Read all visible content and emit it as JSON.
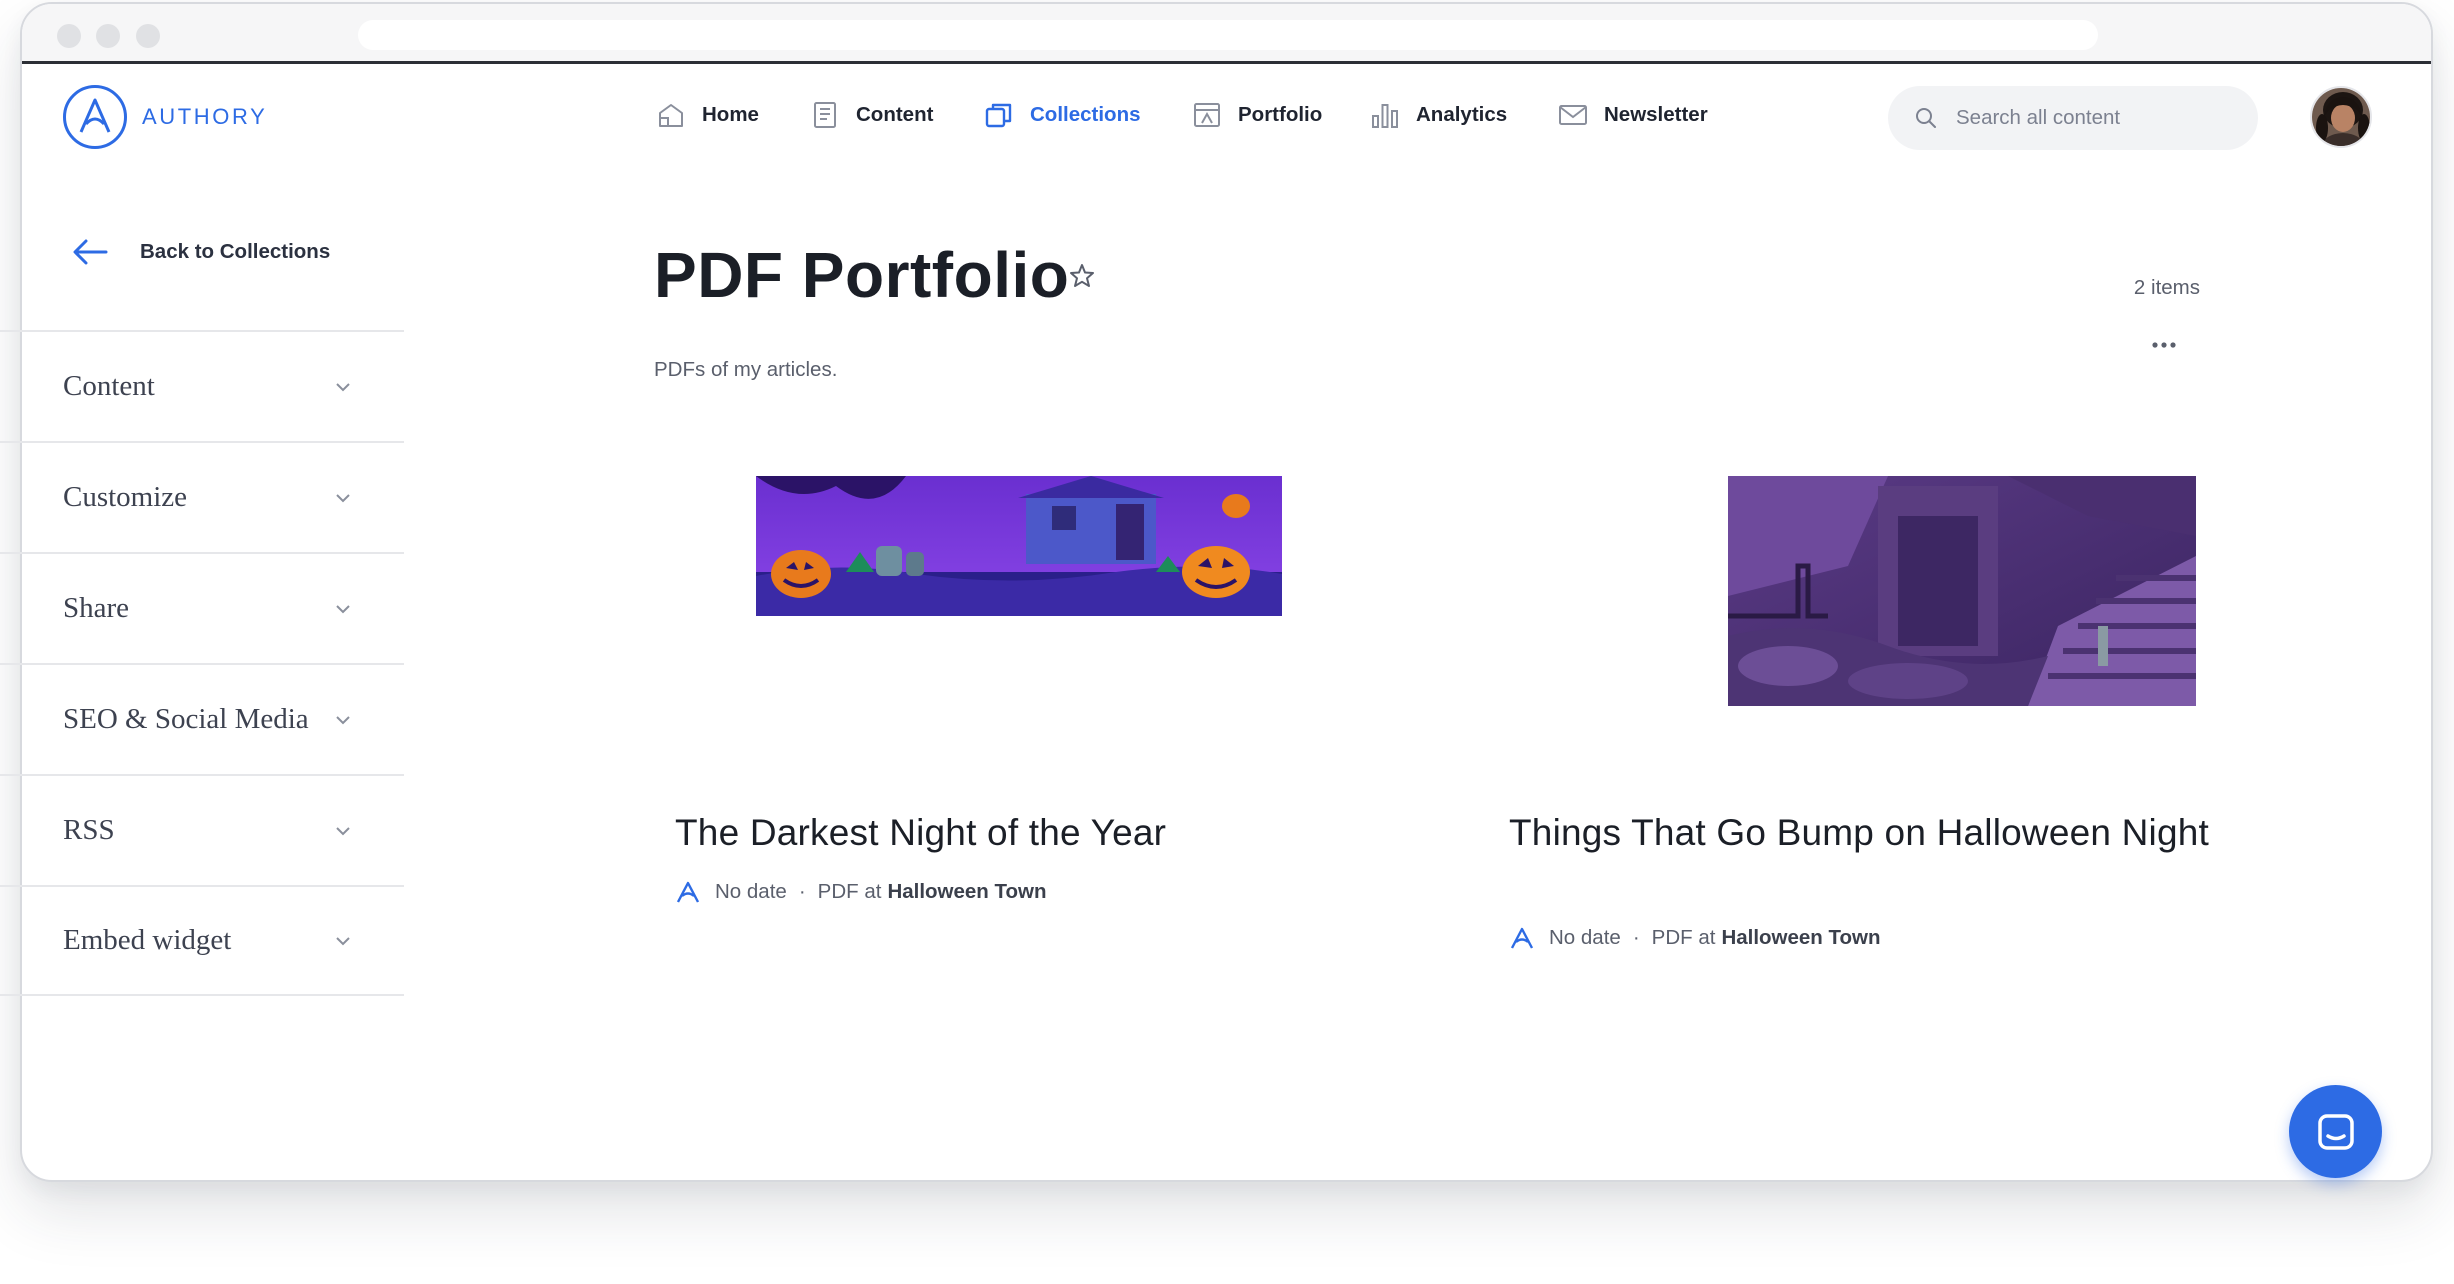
{
  "brand": {
    "name": "AUTHORY",
    "accent": "#2d6be4"
  },
  "nav": {
    "items": [
      {
        "label": "Home",
        "icon": "home-icon",
        "active": false
      },
      {
        "label": "Content",
        "icon": "content-icon",
        "active": false
      },
      {
        "label": "Collections",
        "icon": "collections-icon",
        "active": true
      },
      {
        "label": "Portfolio",
        "icon": "portfolio-icon",
        "active": false
      },
      {
        "label": "Analytics",
        "icon": "analytics-icon",
        "active": false
      },
      {
        "label": "Newsletter",
        "icon": "newsletter-icon",
        "active": false
      }
    ]
  },
  "search": {
    "placeholder": "Search all content"
  },
  "sidebar": {
    "back_label": "Back to Collections",
    "sections": [
      {
        "label": "Content"
      },
      {
        "label": "Customize"
      },
      {
        "label": "Share"
      },
      {
        "label": "SEO & Social Media"
      },
      {
        "label": "RSS"
      },
      {
        "label": "Embed widget"
      }
    ]
  },
  "collection": {
    "title": "PDF Portfolio",
    "description": "PDFs of my articles.",
    "item_count": "2 items"
  },
  "items": [
    {
      "title": "The Darkest Night of the Year",
      "date": "No date",
      "type_prefix": "PDF at",
      "publication": "Halloween Town",
      "image": "halloween-pumpkins-banner"
    },
    {
      "title": "Things That Go Bump on Halloween Night",
      "date": "No date",
      "type_prefix": "PDF at",
      "publication": "Halloween Town",
      "image": "spooky-stairs-illustration"
    }
  ],
  "colors": {
    "accent": "#2d6be4",
    "text": "#1f2430",
    "muted": "#5a5f6c"
  }
}
